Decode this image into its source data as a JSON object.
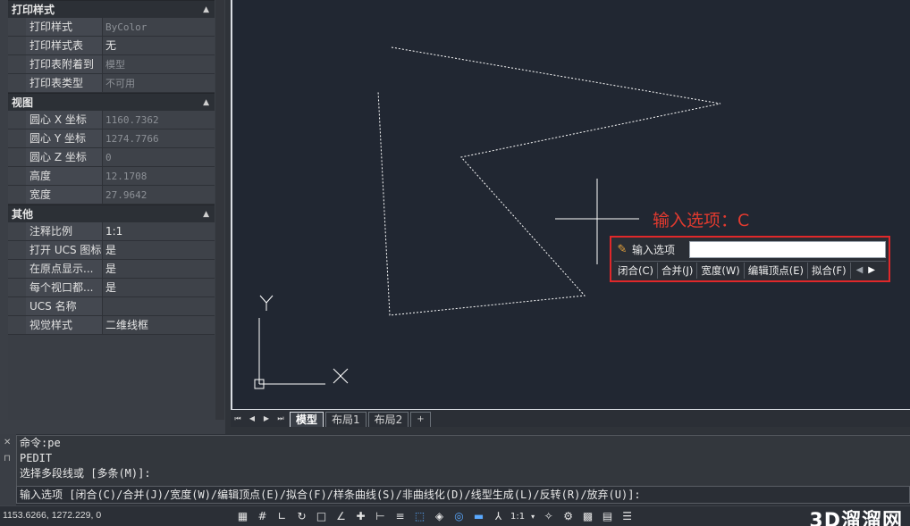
{
  "properties": {
    "sections": [
      {
        "title": "打印样式",
        "rows": [
          {
            "key": "打印样式",
            "value": "ByColor",
            "dim": true
          },
          {
            "key": "打印样式表",
            "value": "无",
            "dim": false
          },
          {
            "key": "打印表附着到",
            "value": "模型",
            "dim": true
          },
          {
            "key": "打印表类型",
            "value": "不可用",
            "dim": true
          }
        ]
      },
      {
        "title": "视图",
        "rows": [
          {
            "key": "圆心 X 坐标",
            "value": "1160.7362",
            "dim": true
          },
          {
            "key": "圆心 Y 坐标",
            "value": "1274.7766",
            "dim": true
          },
          {
            "key": "圆心 Z 坐标",
            "value": "0",
            "dim": true
          },
          {
            "key": "高度",
            "value": "12.1708",
            "dim": true
          },
          {
            "key": "宽度",
            "value": "27.9642",
            "dim": true
          }
        ]
      },
      {
        "title": "其他",
        "rows": [
          {
            "key": "注释比例",
            "value": "1:1",
            "dim": false
          },
          {
            "key": "打开 UCS 图标",
            "value": "是",
            "dim": false
          },
          {
            "key": "在原点显示...",
            "value": "是",
            "dim": false
          },
          {
            "key": "每个视口都...",
            "value": "是",
            "dim": false
          },
          {
            "key": "UCS 名称",
            "value": "",
            "dim": false
          },
          {
            "key": "视觉样式",
            "value": "二维线框",
            "dim": false
          }
        ]
      }
    ]
  },
  "canvas": {
    "prompt_label": "输入选项：C",
    "ucs_y": "Y",
    "ucs_x": "X",
    "dynamic_input": {
      "label": "输入选项",
      "value": "",
      "options": [
        "闭合(C)",
        "合并(J)",
        "宽度(W)",
        "编辑顶点(E)",
        "拟合(F)"
      ]
    }
  },
  "tabs": {
    "items": [
      {
        "label": "模型",
        "active": true
      },
      {
        "label": "布局1",
        "active": false
      },
      {
        "label": "布局2",
        "active": false
      }
    ],
    "add_label": "+"
  },
  "command": {
    "history": [
      "命令:pe",
      "PEDIT",
      "选择多段线或 [多条(M)]:"
    ],
    "current": "输入选项 [闭合(C)/合并(J)/宽度(W)/编辑顶点(E)/拟合(F)/样条曲线(S)/非曲线化(D)/线型生成(L)/反转(R)/放弃(U)]:"
  },
  "status": {
    "coords": "1153.6266, 1272.229, 0",
    "scale": "1:1",
    "watermark": "3D溜溜网"
  },
  "colors": {
    "canvas_bg": "#212732",
    "prompt_red": "#e0282a",
    "panel_bg": "#3a3e45"
  }
}
